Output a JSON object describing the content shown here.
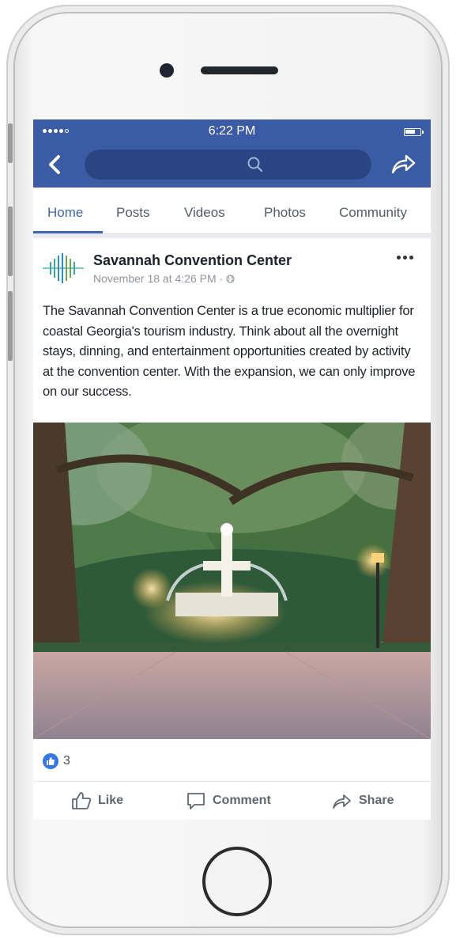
{
  "status_bar": {
    "time": "6:22 PM"
  },
  "tabs": [
    {
      "label": "Home",
      "active": true
    },
    {
      "label": "Posts"
    },
    {
      "label": "Videos"
    },
    {
      "label": "Photos"
    },
    {
      "label": "Community"
    }
  ],
  "post": {
    "page_name": "Savannah Convention Center",
    "meta": "November 18 at 4:26 PM · ",
    "text": "The Savannah Convention Center is a true economic multiplier for coastal Georgia's tourism industry. Think about all the overnight stays, dinning, and entertainment opportunities created by activity at the convention center. With the expansion, we can only improve on our success.",
    "photo_icon": "fountain-park-photo",
    "reaction_count": "3"
  },
  "actions": {
    "like": "Like",
    "comment": "Comment",
    "share": "Share"
  },
  "colors": {
    "facebook_blue": "#3b5ba5",
    "accent": "#4267b2",
    "like_blue": "#3578e5"
  },
  "icons": [
    "back-chevron-icon",
    "search-icon",
    "share-arrow-icon",
    "more-dots-icon",
    "globe-icon",
    "like-thumb-icon",
    "comment-bubble-icon",
    "home-button"
  ]
}
